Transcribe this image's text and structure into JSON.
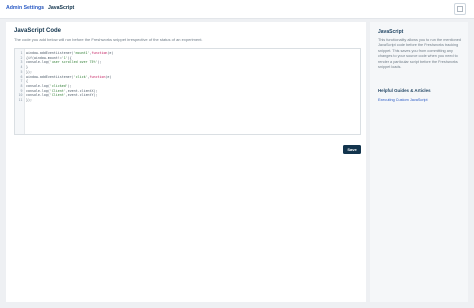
{
  "breadcrumb": {
    "root": "Admin Settings",
    "separator": "›",
    "current": "JavaScript"
  },
  "header": {
    "action_icon": "checkbox-icon"
  },
  "main": {
    "title": "JavaScript Code",
    "description": "The code you add below will run before the Freshworks snippet irrespective of the status of an experiment.",
    "code_lines": [
      {
        "n": "1",
        "text": "window.addEventListener('mount1',function(e)"
      },
      {
        "n": "2",
        "text": "{if(window.mount!='1'){"
      },
      {
        "n": "3",
        "text": "console.log('user scrolled over 75%');"
      },
      {
        "n": "4",
        "text": "}"
      },
      {
        "n": "5",
        "text": "});"
      },
      {
        "n": "6",
        "text": "window.addEventListener('click',function(e)"
      },
      {
        "n": "7",
        "text": "{"
      },
      {
        "n": "8",
        "text": "console.log('clicked');"
      },
      {
        "n": "9",
        "text": "console.log('Client',event.clientX);"
      },
      {
        "n": "10",
        "text": "console.log('Client',event.clientY);"
      },
      {
        "n": "11",
        "text": "});"
      }
    ],
    "save_label": "Save"
  },
  "sidebar": {
    "title": "JavaScript",
    "body": "This functionality allows you to run the mentioned JavaScript code before the Freshworks tracking snippet. This saves you from committing any changes to your source code when you need to render a particular script before the Freshworks snippet loads.",
    "guides_title": "Helpful Guides & Articles",
    "link_label": "Executing Custom JavaScript"
  },
  "colors": {
    "accent": "#2c5cc5",
    "button": "#12344d",
    "background": "#eef0f3"
  }
}
